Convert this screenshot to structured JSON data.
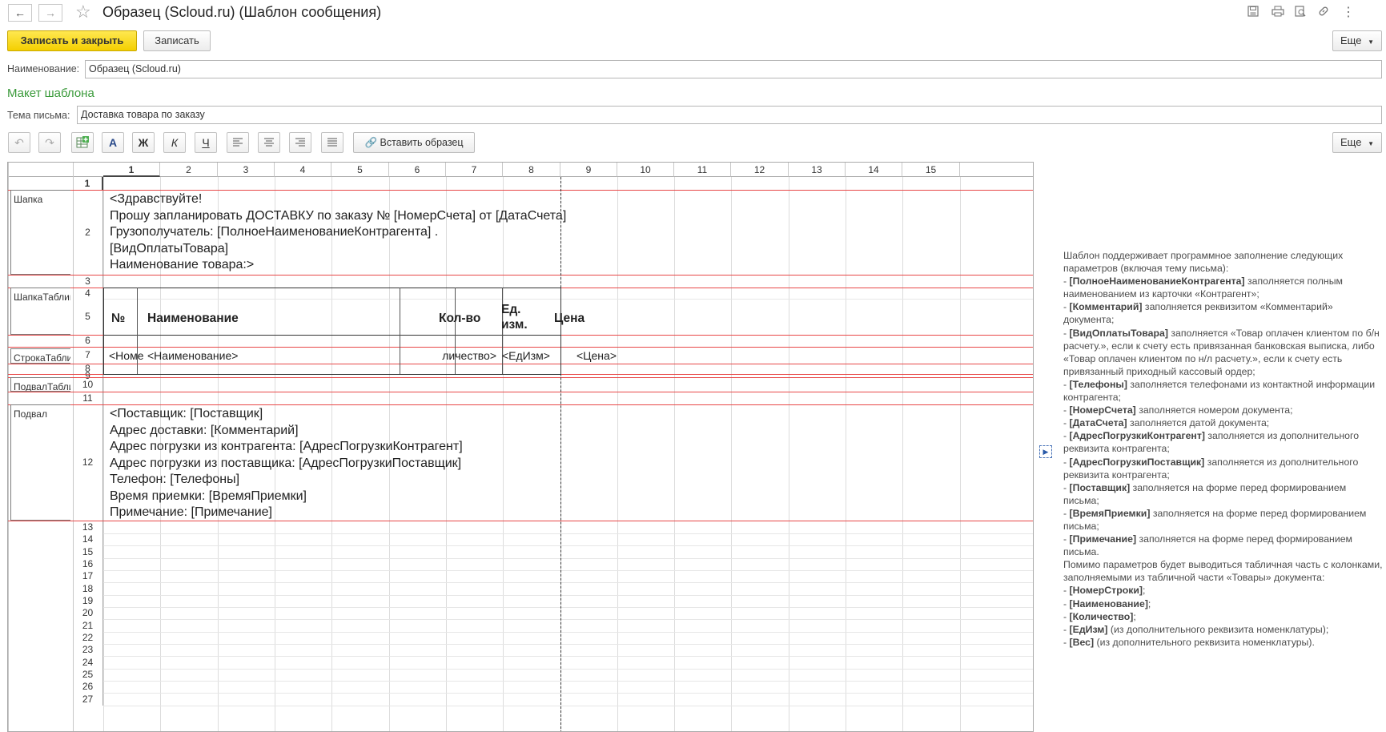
{
  "window": {
    "title": "Образец (Scloud.ru) (Шаблон сообщения)",
    "icons": [
      "back-arrow-icon",
      "forward-arrow-icon",
      "star-icon",
      "save-icon",
      "print-icon",
      "preview-icon",
      "link-icon",
      "more-vertical-icon"
    ]
  },
  "toolbar": {
    "save_close_label": "Записать и закрыть",
    "save_label": "Записать",
    "more_label": "Еще"
  },
  "form": {
    "name_label": "Наименование:",
    "name_value": "Образец (Scloud.ru)",
    "section_title": "Макет шаблона",
    "subject_label": "Тема письма:",
    "subject_value": "Доставка товара по заказу"
  },
  "format_toolbar": {
    "font_label": "A",
    "bold_label": "Ж",
    "italic_label": "К",
    "underline_label": "Ч",
    "insert_sample_label": "Вставить образец",
    "more_label": "Еще"
  },
  "sheet": {
    "columns": [
      "1",
      "2",
      "3",
      "4",
      "5",
      "6",
      "7",
      "8",
      "9",
      "10",
      "11",
      "12",
      "13",
      "14",
      "15"
    ],
    "rows": [
      "1",
      "2",
      "3",
      "4",
      "5",
      "6",
      "7",
      "8",
      "9",
      "10",
      "11",
      "12",
      "13",
      "14",
      "15",
      "16",
      "17",
      "18",
      "19",
      "20",
      "21",
      "22",
      "23",
      "24",
      "25",
      "26",
      "27"
    ],
    "areas": {
      "header": "Шапка",
      "table_header": "ШапкаТаблицы",
      "table_row": "СтрокаТаблицы",
      "table_footer": "ПодвалТаблицы",
      "footer": "Подвал"
    },
    "header_lines": [
      "<Здравствуйте!",
      "Прошу запланировать ДОСТАВКУ по заказу № [НомерСчета] от [ДатаСчета]",
      "Грузополучатель: [ПолноеНаименованиеКонтрагента] .",
      "[ВидОплатыТовара]",
      "Наименование товара:>"
    ],
    "table_headers": {
      "num": "№",
      "name": "Наименование",
      "qty": "Кол-во",
      "unit_1": "Ед.",
      "unit_2": "изм.",
      "price": "Цена"
    },
    "table_row": {
      "num": "<Номе",
      "name": "<Наименование>",
      "qty": "личество>",
      "unit": "<ЕдИзм>",
      "price": "<Цена>"
    },
    "footer_lines": [
      "<Поставщик: [Поставщик]",
      "Адрес доставки: [Комментарий]",
      "Адрес погрузки из контрагента: [АдресПогрузкиКонтрагент]",
      "Адрес погрузки из поставщика: [АдресПогрузкиПоставщик]",
      "Телефон: [Телефоны]",
      "Время приемки: [ВремяПриемки]",
      "Примечание: [Примечание]"
    ]
  },
  "help": {
    "intro": "Шаблон поддерживает программное заполнение следующих параметров (включая тему письма):",
    "params": [
      {
        "name": "[ПолноеНаименованиеКонтрагента]",
        "text": " заполняется полным наименованием из карточки «Контрагент»;"
      },
      {
        "name": "[Комментарий]",
        "text": " заполняется реквизитом «Комментарий» документа;"
      },
      {
        "name": "[ВидОплатыТовара]",
        "text": " заполняется «Товар оплачен клиентом по б/н расчету.», если к счету есть привязанная банковская выписка, либо «Товар оплачен клиентом по н/л расчету.», если к счету есть привязанный приходный кассовый ордер;"
      },
      {
        "name": "[Телефоны]",
        "text": " заполняется телефонами из контактной информации контрагента;"
      },
      {
        "name": "[НомерСчета]",
        "text": " заполняется номером документа;"
      },
      {
        "name": "[ДатаСчета]",
        "text": " заполняется датой документа;"
      },
      {
        "name": "[АдресПогрузкиКонтрагент]",
        "text": " заполняется из дополнительного реквизита контрагента;"
      },
      {
        "name": "[АдресПогрузкиПоставщик]",
        "text": " заполняется из дополнительного реквизита контрагента;"
      },
      {
        "name": "[Поставщик]",
        "text": " заполняется на форме перед формированием письма;"
      },
      {
        "name": "[ВремяПриемки]",
        "text": " заполняется на форме перед формированием письма;"
      },
      {
        "name": "[Примечание]",
        "text": " заполняется на форме перед формированием письма."
      }
    ],
    "table_intro": "Помимо параметров будет выводиться табличная часть с колонками, заполняемыми из табличной части «Товары» документа:",
    "columns": [
      {
        "name": "[НомерСтроки]",
        "text": ";"
      },
      {
        "name": "[Наименование]",
        "text": ";"
      },
      {
        "name": "[Количество]",
        "text": ";"
      },
      {
        "name": "[ЕдИзм]",
        "text": " (из дополнительного реквизита номенклатуры);"
      },
      {
        "name": "[Вес]",
        "text": " (из дополнительного реквизита номенклатуры)."
      }
    ]
  }
}
